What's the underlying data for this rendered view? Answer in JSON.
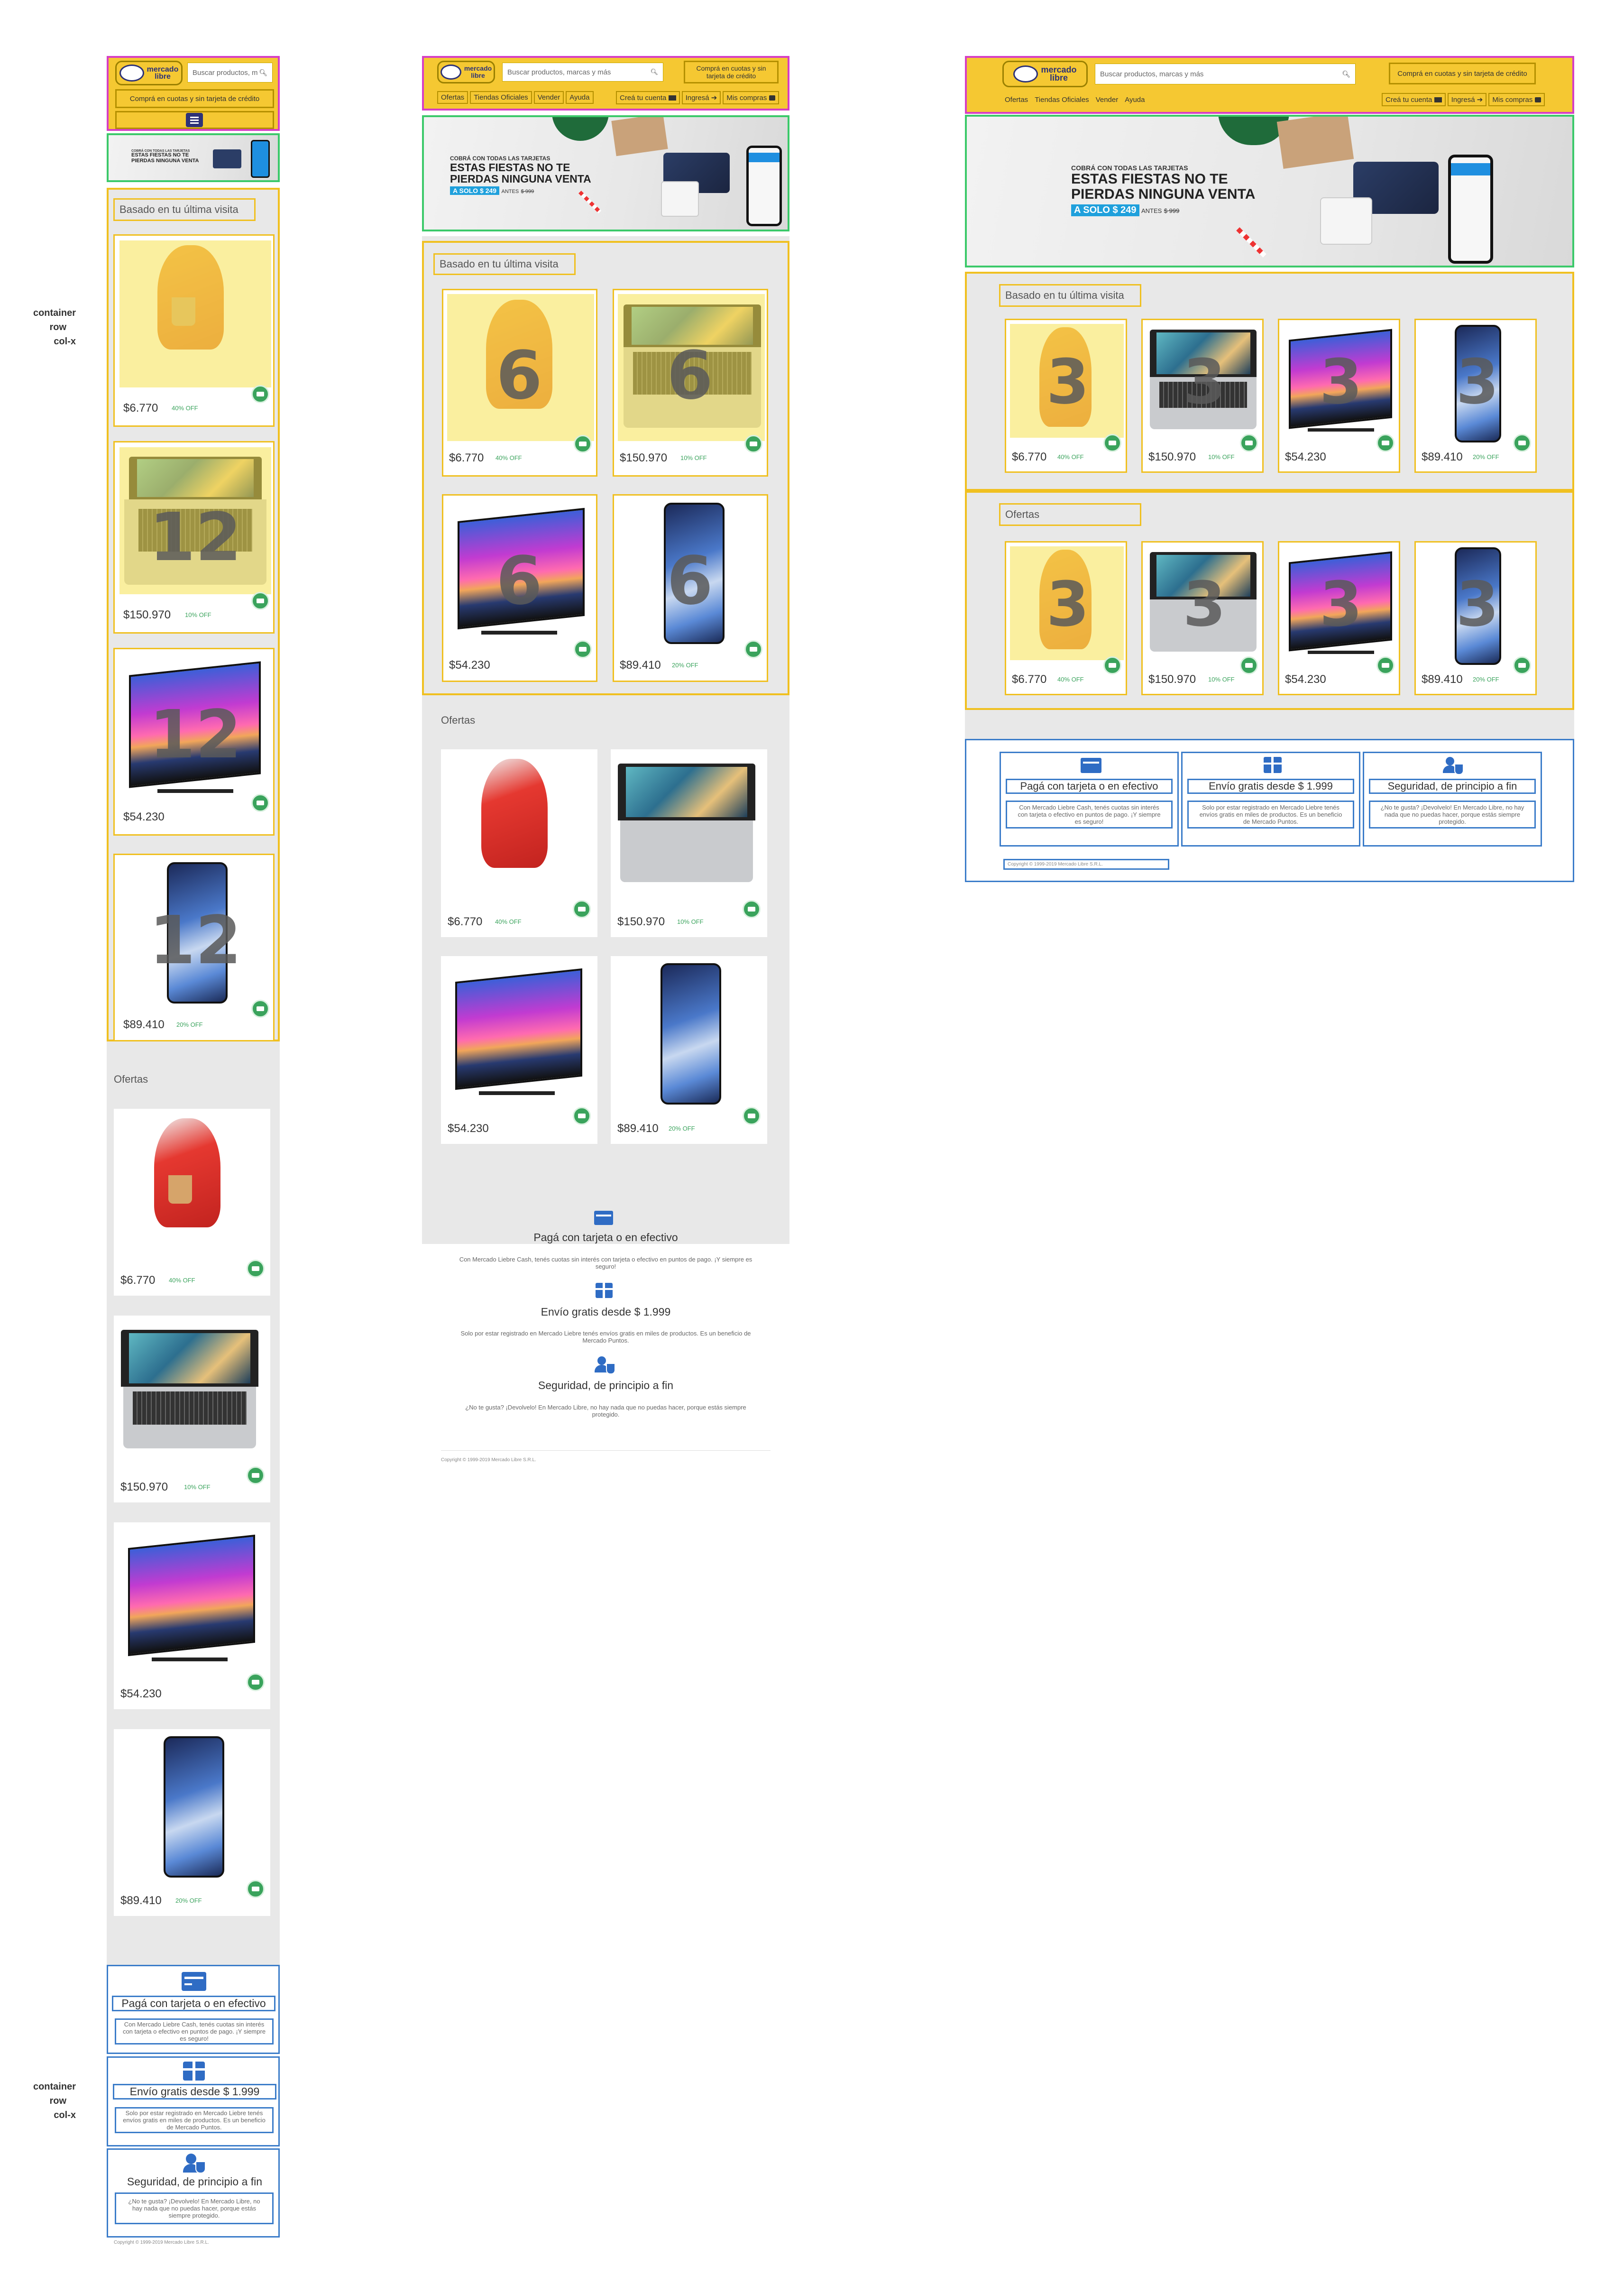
{
  "side_labels": {
    "top": [
      "container",
      "row",
      "col-x"
    ],
    "bottom": [
      "container",
      "row",
      "col-x"
    ]
  },
  "brand": {
    "logo_line1": "mercado",
    "logo_line2": "libre"
  },
  "header": {
    "search_placeholder_mobile": "Buscar productos, m",
    "search_placeholder": "Buscar productos, marcas y más",
    "credit_mobile": "Comprá en cuotas y sin tarjeta de crédito",
    "credit_tablet_line1": "Comprá en cuotas y sin",
    "credit_tablet_line2": "tarjeta de crédito",
    "credit_desktop": "Comprá en cuotas y sin tarjeta de crédito",
    "menu_icon": "hamburger-icon",
    "nav": [
      "Ofertas",
      "Tiendas Oficiales",
      "Vender",
      "Ayuda"
    ],
    "account": [
      "Creá tu cuenta",
      "Ingresá",
      "Mis compras"
    ]
  },
  "banner": {
    "small": "COBRÁ CON TODAS LAS TARJETAS",
    "big_line1": "ESTAS FIESTAS NO TE",
    "big_line2": "PIERDAS NINGUNA VENTA",
    "price": "A SOLO $ 249",
    "antes": "ANTES",
    "antes_price": "$ 999"
  },
  "sections": {
    "last_visit": "Basado en tu última visita",
    "offers": "Ofertas"
  },
  "products": [
    {
      "name": "Cafetera Dolce Gusto",
      "price": "$6.770",
      "off": "40% OFF"
    },
    {
      "name": "MacBook",
      "price": "$150.970",
      "off": "10% OFF"
    },
    {
      "name": "Smart TV",
      "price": "$54.230",
      "off": ""
    },
    {
      "name": "Samsung Galaxy",
      "price": "$89.410",
      "off": "20% OFF"
    }
  ],
  "grid_numbers": {
    "mobile": "12",
    "tablet": "6",
    "desktop": "3"
  },
  "features": [
    {
      "icon": "credit-card-icon",
      "title": "Pagá con tarjeta o en efectivo",
      "text_mobile": "Con Mercado Liebre Cash, tenés cuotas sin interés con tarjeta o efectivo en puntos de pago. ¡Y siempre es seguro!",
      "text": "Con Mercado Liebre Cash, tenés cuotas sin interés con tarjeta o efectivo en puntos de pago. ¡Y siempre es seguro!"
    },
    {
      "icon": "gift-icon",
      "title": "Envío gratis desde $ 1.999",
      "text_mobile": "Solo por estar registrado en Mercado Liebre tenés envíos gratis en miles de productos. Es un beneficio de Mercado Puntos.",
      "text": "Solo por estar registrado en Mercado Liebre tenés envíos gratis en miles de productos. Es un beneficio de Mercado Puntos."
    },
    {
      "icon": "user-shield-icon",
      "title": "Seguridad, de principio a fin",
      "text_mobile": "¿No te gusta? ¡Devolvelo! En Mercado Libre, no hay nada que no puedas hacer, porque estás siempre protegido.",
      "text": "¿No te gusta? ¡Devolvelo! En Mercado Libre, no hay nada que no puedas hacer, porque estás siempre protegido."
    }
  ],
  "footer": {
    "copyright": "Copyright © 1999-2019 Mercado Libre S.R.L."
  },
  "colors": {
    "header": "#f5c832",
    "header_outline": "#d63ec5",
    "banner_outline": "#3cc96a",
    "section_outline": "#f0c020",
    "feature_outline": "#3b7cc9",
    "offer_green": "#3aa35c",
    "banner_price": "#1fa0dc"
  }
}
